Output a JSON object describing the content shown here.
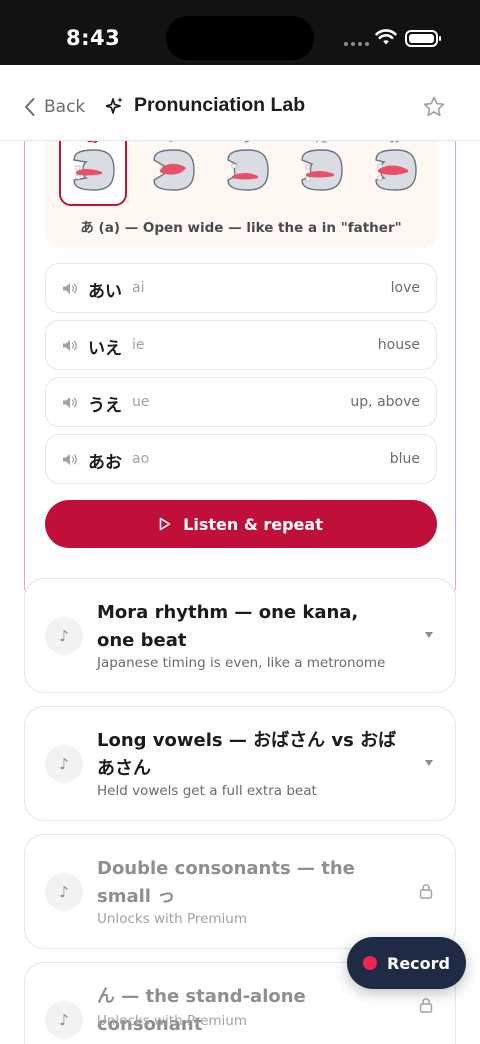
{
  "status_bar": {
    "time": "8:43"
  },
  "nav": {
    "back_label": "Back",
    "title": "Pronunciation Lab",
    "icons": [
      "chevron-left-icon",
      "sparkle-icon",
      "star-icon"
    ]
  },
  "vowels": {
    "items": [
      {
        "kana": "あ",
        "selected": true
      },
      {
        "kana": "い",
        "selected": false
      },
      {
        "kana": "う",
        "selected": false
      },
      {
        "kana": "え",
        "selected": false
      },
      {
        "kana": "お",
        "selected": false
      }
    ],
    "caption": "あ (a) — Open wide — like the a in \"father\"",
    "words": [
      {
        "kana": "あい",
        "romaji": "ai",
        "meaning": "love"
      },
      {
        "kana": "いえ",
        "romaji": "ie",
        "meaning": "house"
      },
      {
        "kana": "うえ",
        "romaji": "ue",
        "meaning": "up, above"
      },
      {
        "kana": "あお",
        "romaji": "ao",
        "meaning": "blue"
      }
    ],
    "listen_label": "Listen & repeat"
  },
  "lessons": [
    {
      "title": "Mora rhythm — one kana, one beat",
      "subtitle": "Japanese timing is even, like a metronome",
      "locked": false
    },
    {
      "title": "Long vowels — おばさん vs おばあさん",
      "subtitle": "Held vowels get a full extra beat",
      "locked": false
    },
    {
      "title": "Double consonants — the small っ",
      "subtitle": "Unlocks with Premium",
      "locked": true
    },
    {
      "title": "ん — the stand-alone consonant",
      "subtitle": "Unlocks with Premium",
      "locked": true
    }
  ],
  "record": {
    "label": "Record"
  },
  "colors": {
    "accent": "#c0103a",
    "record_bg": "#1f2a44",
    "panel_bg": "#fff7f1"
  }
}
